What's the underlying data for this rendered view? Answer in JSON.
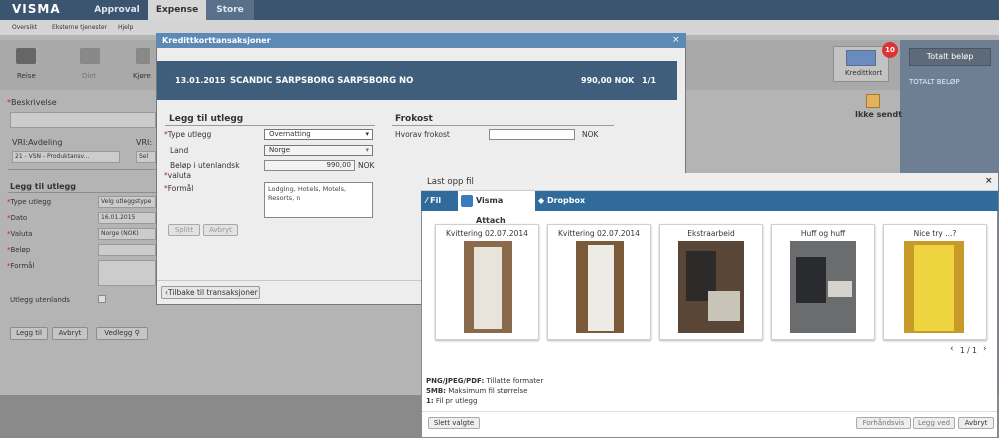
{
  "topbar": {
    "logo": "VISMA",
    "tabs": [
      "Approval",
      "Expense",
      "Store"
    ]
  },
  "subnav": [
    "Oversikt",
    "Eksterne tjenester",
    "Hjelp"
  ],
  "ribbon": [
    "Reise",
    "Diet",
    "Kjøre"
  ],
  "right": {
    "kreditkort_label": "Kredittkort",
    "badge": "10",
    "totalt_belop_button": "Totalt beløp",
    "totalt_belop_label": "TOTALT BELØP",
    "ikke_sendt": "Ikke sendt"
  },
  "bg_form": {
    "beskrivelse": "Beskrivelse",
    "avdeling": "VRI:Avdeling",
    "vri2": "VRI:",
    "avdeling_value": "21 - VSN - Produktansv...",
    "sel2": "Sel",
    "heading": "Legg til utlegg",
    "labels": [
      "Type utlegg",
      "Dato",
      "Valuta",
      "Beløp",
      "Formål"
    ],
    "type_value": "Velg utleggstype",
    "dato_value": "16.01.2015",
    "valuta_value": "Norge (NOK)",
    "utenlands": "Utlegg utenlands",
    "btn_legg": "Legg til",
    "btn_avbryt": "Avbryt",
    "btn_vedlegg": "Vedlegg"
  },
  "dialog1": {
    "title": "Kredittkorttansaksjoner",
    "close": "×",
    "transaction": {
      "date": "13.01.2015",
      "merchant": "SCANDIC SARPSBORG SARPSBORG NO",
      "amount": "990,00 NOK",
      "page": "1/1"
    },
    "left_heading": "Legg til utlegg",
    "type_label": "Type utlegg",
    "type_value": "Overnatting",
    "land_label": "Land",
    "land_value": "Norge",
    "belop_label": "Beløp i utenlandsk",
    "belop_value": "990,00",
    "belop_unit": "NOK",
    "valuta_label": "valuta",
    "formal_label": "Formål",
    "formal_value": "Lodging, Hotels, Motels, Resorts, n",
    "btn_splitt": "Splitt",
    "btn_avbryt": "Avbryt",
    "right_heading": "Frokost",
    "frokost_label": "Hvorav frokost",
    "frokost_unit": "NOK",
    "back_button": "Tilbake til transaksjoner"
  },
  "dialog2": {
    "title": "Last opp fil",
    "close": "×",
    "tabs": [
      "Fil",
      "Visma Attach",
      "Dropbox"
    ],
    "cards": [
      {
        "title": "Kvittering 02.07.2014"
      },
      {
        "title": "Kvittering 02.07.2014"
      },
      {
        "title": "Ekstraarbeid"
      },
      {
        "title": "Huff og huff"
      },
      {
        "title": "Nice try ...?"
      }
    ],
    "pagination": {
      "prev": "‹",
      "text": "1 / 1",
      "next": "›"
    },
    "info": [
      {
        "b": "PNG/JPEG/PDF:",
        "t": "Tillatte formater"
      },
      {
        "b": "5MB:",
        "t": "Maksimum fil størrelse"
      },
      {
        "b": "1:",
        "t": "Fil pr utlegg"
      }
    ],
    "btn_slett": "Slett valgte",
    "btn_forhand": "Forhåndsvis",
    "btn_leggved": "Legg ved",
    "btn_avbryt": "Avbryt"
  },
  "colors": {
    "topbar": "#3b5570",
    "dialog_header": "#5c89b5",
    "transaction_bar": "#3e5e7c",
    "tab_bar": "#306b9c",
    "required": "#c1272d"
  }
}
